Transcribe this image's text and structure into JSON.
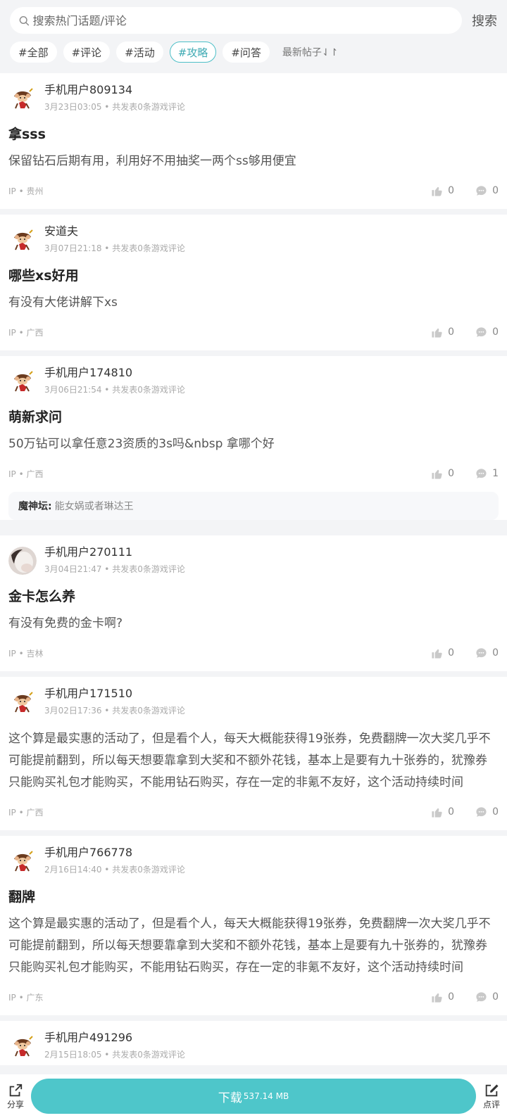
{
  "search": {
    "placeholder": "搜索热门话题/评论",
    "button": "搜索"
  },
  "tags": [
    "#全部",
    "#评论",
    "#活动",
    "#攻略",
    "#问答"
  ],
  "active_tag": "#攻略",
  "sort_label": "最新帖子",
  "posts": [
    {
      "user": "手机用户809134",
      "sub": "3月23日03:05 • 共发表0条游戏评论",
      "title": "拿sss",
      "content": "保留钻石后期有用，利用好不用抽奖一两个ss够用便宜",
      "ip": "IP • 贵州",
      "likes": "0",
      "comments": "0"
    },
    {
      "user": "安道夫",
      "sub": "3月07日21:18 • 共发表0条游戏评论",
      "title": "哪些xs好用",
      "content": "有没有大佬讲解下xs",
      "ip": "IP • 广西",
      "likes": "0",
      "comments": "0"
    },
    {
      "user": "手机用户174810",
      "sub": "3月06日21:54 • 共发表0条游戏评论",
      "title": "萌新求问",
      "content": "50万钻可以拿任意23资质的3s吗&nbsp 拿哪个好",
      "ip": "IP • 广西",
      "likes": "0",
      "comments": "1",
      "reply_author": "魔神坛:",
      "reply_text": "能女娲或者琳达王"
    },
    {
      "user": "手机用户270111",
      "sub": "3月04日21:47 • 共发表0条游戏评论",
      "title": "金卡怎么养",
      "content": "有没有免费的金卡啊?",
      "ip": "IP • 吉林",
      "likes": "0",
      "comments": "0"
    },
    {
      "user": "手机用户171510",
      "sub": "3月02日17:36 • 共发表0条游戏评论",
      "title": "",
      "content": "这个算是最实惠的活动了，但是看个人，每天大概能获得19张券，免费翻牌一次大奖几乎不可能提前翻到，所以每天想要靠拿到大奖和不额外花钱，基本上是要有九十张券的，犹豫券只能购买礼包才能购买，不能用钻石购买，存在一定的非氪不友好，这个活动持续时间",
      "ip": "IP • 广西",
      "likes": "0",
      "comments": "0"
    },
    {
      "user": "手机用户766778",
      "sub": "2月16日14:40 • 共发表0条游戏评论",
      "title": "翻牌",
      "content": "这个算是最实惠的活动了，但是看个人，每天大概能获得19张券，免费翻牌一次大奖几乎不可能提前翻到，所以每天想要靠拿到大奖和不额外花钱，基本上是要有九十张券的，犹豫券只能购买礼包才能购买，不能用钻石购买，存在一定的非氪不友好，这个活动持续时间",
      "ip": "IP • 广东",
      "likes": "0",
      "comments": "0"
    },
    {
      "user": "手机用户491296",
      "sub": "2月15日18:05 • 共发表0条游戏评论"
    }
  ],
  "bottom": {
    "share": "分享",
    "download": "下载",
    "size": "537.14 MB",
    "review": "点评"
  },
  "colors": {
    "accent": "#4ec6ca",
    "active_tag": "#3eaab3"
  }
}
